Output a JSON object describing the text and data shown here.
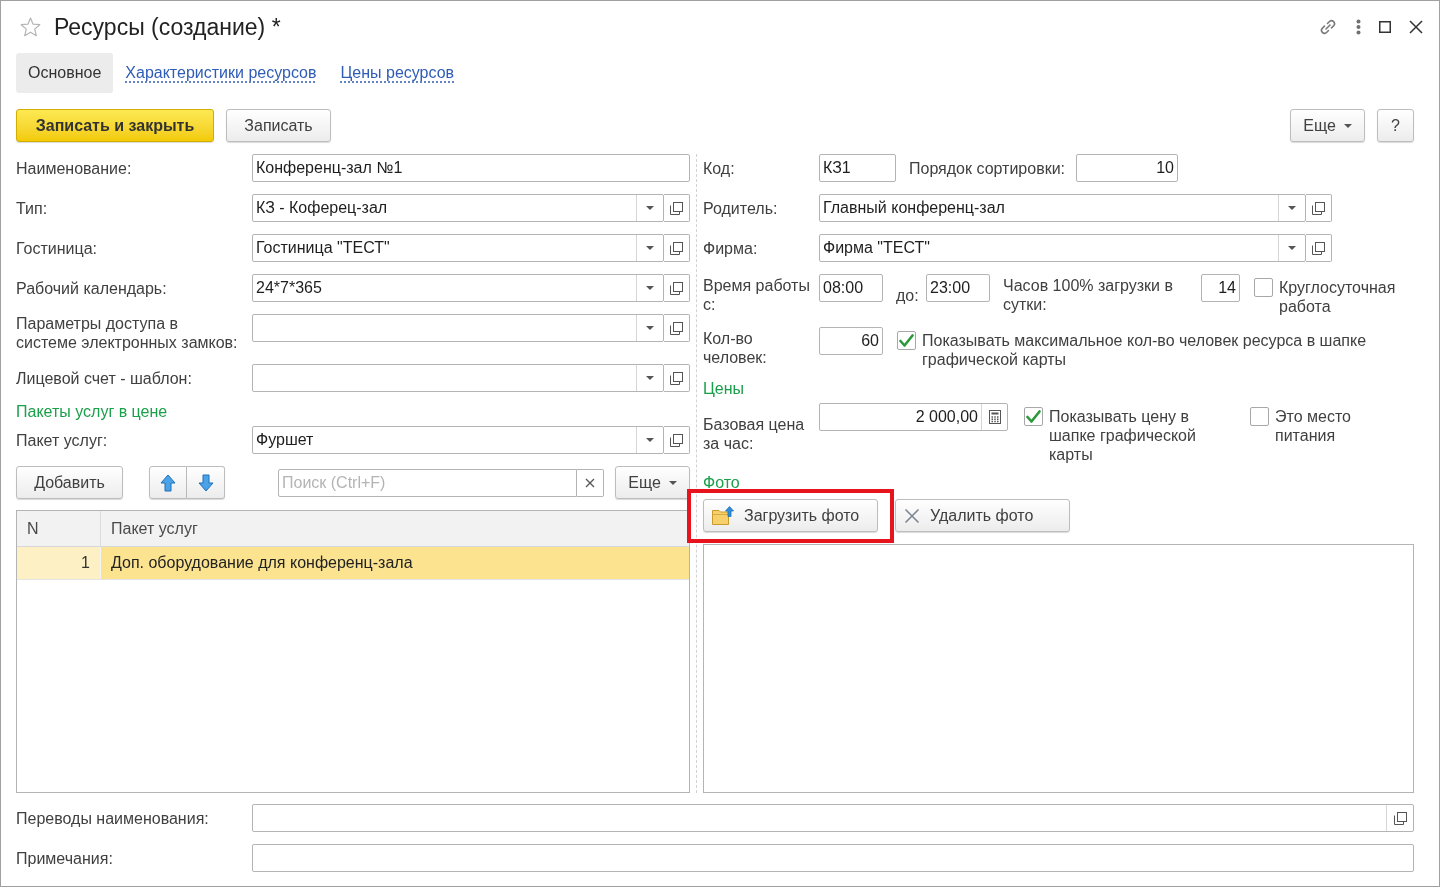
{
  "window": {
    "title": "Ресурсы (создание) *",
    "favorite": false
  },
  "tabs": [
    {
      "label": "Основное",
      "selected": true
    },
    {
      "label": "Характеристики ресурсов",
      "selected": false
    },
    {
      "label": "Цены ресурсов",
      "selected": false
    }
  ],
  "command_bar": {
    "buttons": [
      {
        "label": "Записать и закрыть",
        "kind": "primary"
      },
      {
        "label": "Записать",
        "kind": "default"
      }
    ],
    "more": "Еще",
    "help": "?"
  },
  "main_fields": [
    {
      "label": "Наименование:",
      "value": "Конференц-зал №1",
      "kind": "text"
    },
    {
      "label": "Тип:",
      "value": "КЗ - Коферец-зал",
      "kind": "select"
    },
    {
      "label": "Гостиница:",
      "value": "Гостиница \"ТЕСТ\"",
      "kind": "select"
    },
    {
      "label": "Рабочий календарь:",
      "value": "24*7*365",
      "kind": "select"
    },
    {
      "label": "Параметры доступа в системе электронных замков:",
      "kind": "select"
    },
    {
      "label": "Лицевой счет - шаблон:",
      "kind": "select"
    }
  ],
  "service_packages": {
    "title": "Пакеты услуг в цене",
    "field": {
      "label": "Пакет услуг:",
      "value": "Фуршет",
      "kind": "select"
    },
    "toolbar": {
      "add": "Добавить",
      "search_placeholder": "Поиск (Ctrl+F)",
      "more": "Еще"
    },
    "table": {
      "columns": [
        "N",
        "Пакет услуг"
      ],
      "rows": [
        {
          "cells": [
            "1",
            "Доп. оборудование для конференц-зала"
          ],
          "selected": true
        }
      ]
    }
  },
  "details": {
    "code": {
      "label": "Код:",
      "value": "КЗ1"
    },
    "sort_order": {
      "label": "Порядок сортировки:",
      "value": "10"
    },
    "parent": {
      "label": "Родитель:",
      "value": "Главный конференц-зал",
      "kind": "select"
    },
    "company": {
      "label": "Фирма:",
      "value": "Фирма \"ТЕСТ\"",
      "kind": "select"
    },
    "work_time": {
      "label": "Время работы с:",
      "from": "08:00",
      "to_label": "до:",
      "to": "23:00"
    },
    "full_load_hours": {
      "label": "Часов 100% загрузки в сутки:",
      "value": "14"
    },
    "round_the_clock": {
      "label": "Круглосуточная работа",
      "checked": false
    },
    "people": {
      "label": "Кол-во человек:",
      "value": "60"
    },
    "show_max_people": {
      "label": "Показывать максимальное кол-во человек ресурса в шапке графической карты",
      "checked": true
    }
  },
  "prices": {
    "title": "Цены",
    "base_price": {
      "label": "Базовая цена за час:",
      "value": "2 000,00"
    },
    "show_price": {
      "label": "Показывать цену в шапке графической карты",
      "checked": true
    },
    "food_place": {
      "label": "Это место питания",
      "checked": false
    }
  },
  "photo": {
    "title": "Фото",
    "buttons": [
      {
        "label": "Загрузить фото",
        "kind": "upload",
        "highlighted": true
      },
      {
        "label": "Удалить фото",
        "kind": "delete",
        "highlighted": false
      }
    ]
  },
  "bottom_fields": [
    {
      "label": "Переводы наименования:",
      "kind": "open"
    },
    {
      "label": "Примечания:",
      "kind": "text"
    }
  ]
}
